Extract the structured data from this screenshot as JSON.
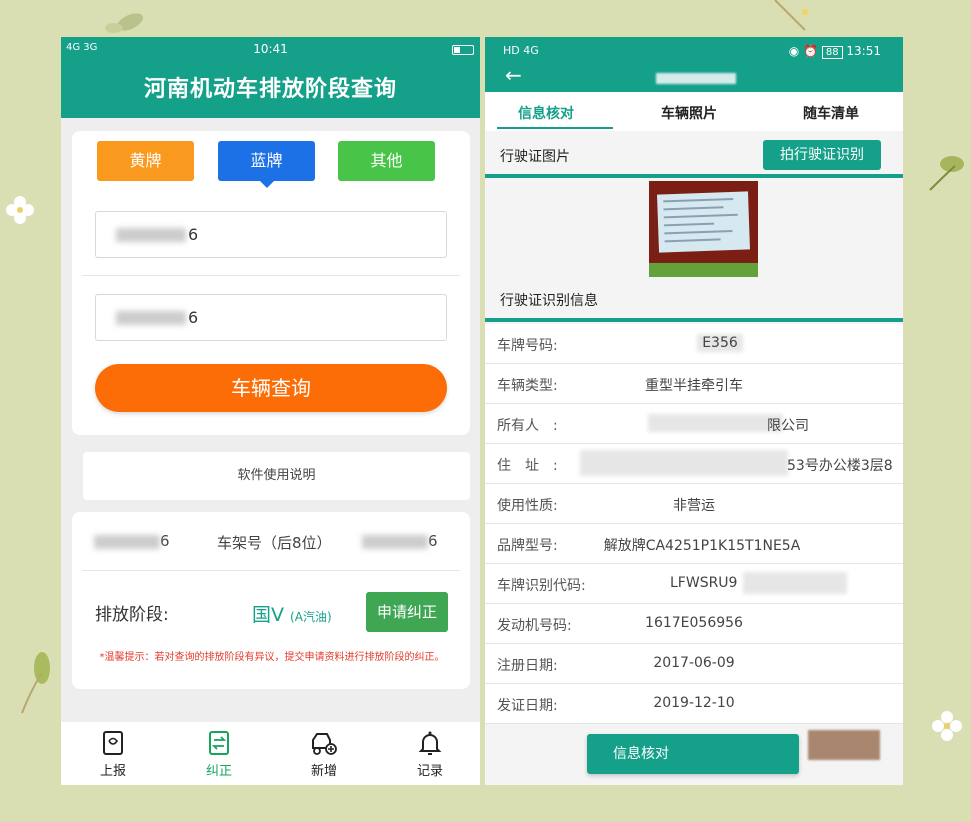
{
  "left_phone": {
    "status_bar": {
      "signal": "4G 3G",
      "time": "10:41"
    },
    "header_title": "河南机动车排放阶段查询",
    "plate_types": [
      "黄牌",
      "蓝牌",
      "其他"
    ],
    "selected_plate_type": "蓝牌",
    "input1_value": "6",
    "input2_value": "6",
    "query_button": "车辆查询",
    "help_link": "软件使用说明",
    "result": {
      "plate_suffix": "6",
      "vin_label": "车架号（后8位）",
      "vin_suffix": "6",
      "stage_label": "排放阶段:",
      "stage_value": "国Ⅴ",
      "fuel": "(A汽油)",
      "correct_button": "申请纠正",
      "tip": "*温馨提示：若对查询的排放阶段有异议，提交申请资料进行排放阶段的纠正。"
    },
    "tabs": [
      {
        "label": "上报",
        "icon": "report-icon"
      },
      {
        "label": "纠正",
        "icon": "correct-icon"
      },
      {
        "label": "新增",
        "icon": "add-vehicle-icon"
      },
      {
        "label": "记录",
        "icon": "bell-icon"
      }
    ],
    "active_tab": "纠正",
    "accent_color": "#15a08a"
  },
  "right_phone": {
    "status_bar": {
      "network": "HD 4G",
      "time": "13:51",
      "battery": "88"
    },
    "tabs": [
      "信息核对",
      "车辆照片",
      "随车清单"
    ],
    "active_tab": "信息核对",
    "license_image_title": "行驶证图片",
    "ocr_button": "拍行驶证识别",
    "info_title": "行驶证识别信息",
    "fields": [
      {
        "label": "车牌号码:",
        "value": "E356"
      },
      {
        "label": "车辆类型:",
        "value": "重型半挂牵引车"
      },
      {
        "label": "所有人　:",
        "value": "限公司"
      },
      {
        "label": "住　址　:",
        "value": "53号办公楼3层8"
      },
      {
        "label": "使用性质:",
        "value": "非营运"
      },
      {
        "label": "品牌型号:",
        "value": "解放牌CA4251P1K15T1NE5A"
      },
      {
        "label": "车牌识别代码:",
        "value": "LFWSRU9"
      },
      {
        "label": "发动机号码:",
        "value": "1617E056956"
      },
      {
        "label": "注册日期:",
        "value": "2017-06-09"
      },
      {
        "label": "发证日期:",
        "value": "2019-12-10"
      }
    ],
    "verify_button": "信息核对"
  }
}
